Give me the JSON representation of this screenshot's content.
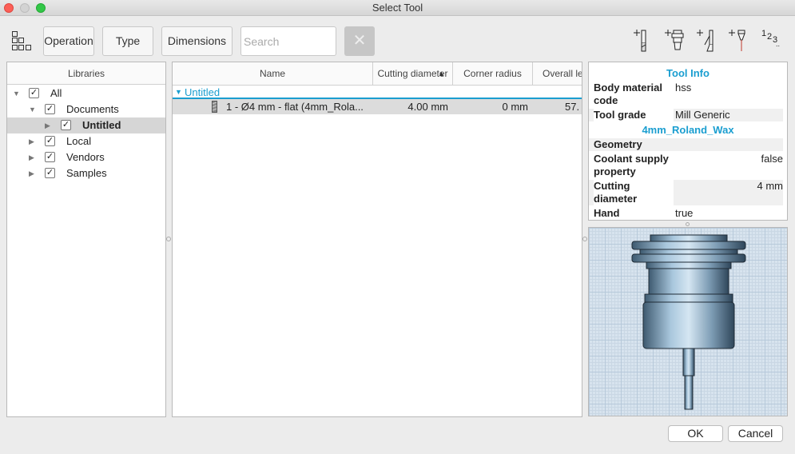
{
  "window": {
    "title": "Select Tool"
  },
  "toolbar": {
    "operation_label": "Operation",
    "type_label": "Type",
    "dimensions_label": "Dimensions",
    "search_placeholder": "Search",
    "clear_label": "✕",
    "number_tools_label": "123"
  },
  "libraries": {
    "header": "Libraries",
    "items": [
      {
        "label": "All",
        "checked": true,
        "expanded": true
      },
      {
        "label": "Documents",
        "checked": true,
        "expanded": true
      },
      {
        "label": "Untitled",
        "checked": true,
        "expanded": false,
        "selected": true
      },
      {
        "label": "Local",
        "checked": true,
        "expanded": false
      },
      {
        "label": "Vendors",
        "checked": true,
        "expanded": false
      },
      {
        "label": "Samples",
        "checked": true,
        "expanded": false
      }
    ]
  },
  "tool_list": {
    "columns": [
      "Name",
      "Cutting diameter",
      "Corner radius",
      "Overall le"
    ],
    "group": "Untitled",
    "rows": [
      {
        "name": "1 - Ø4 mm - flat (4mm_Rola...",
        "cutting_diameter": "4.00 mm",
        "corner_radius": "0 mm",
        "overall_length": "57."
      }
    ]
  },
  "tool_info": {
    "title": "Tool Info",
    "tool_name": "4mm_Roland_Wax",
    "geometry_label": "Geometry",
    "rows": {
      "body_material_key": "Body material code",
      "body_material_value": "hss",
      "tool_grade_key": "Tool grade",
      "tool_grade_value": "Mill Generic",
      "coolant_key": "Coolant supply property",
      "coolant_value": "false",
      "cutting_diameter_key": "Cutting diameter",
      "cutting_diameter_value": "4 mm",
      "hand_key": "Hand",
      "hand_value": "true"
    }
  },
  "buttons": {
    "ok": "OK",
    "cancel": "Cancel"
  },
  "colors": {
    "accent": "#1a9ed0",
    "close": "#fc5f57",
    "maximize": "#33c748"
  }
}
